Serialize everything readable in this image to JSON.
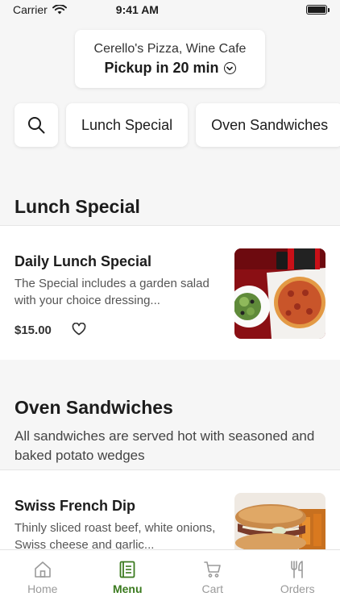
{
  "status_bar": {
    "carrier": "Carrier",
    "time": "9:41 AM"
  },
  "location": {
    "name": "Cerello's Pizza, Wine Cafe",
    "pickup": "Pickup in 20 min"
  },
  "categories": [
    "Lunch Special",
    "Oven Sandwiches"
  ],
  "sections": [
    {
      "title": "Lunch Special",
      "description": "",
      "items": [
        {
          "name": "Daily Lunch Special",
          "description": "The Special includes a garden salad with your choice dressing...",
          "price": "$15.00"
        }
      ]
    },
    {
      "title": "Oven Sandwiches",
      "description": "All sandwiches are served hot with seasoned and baked potato wedges",
      "items": [
        {
          "name": "Swiss French Dip",
          "description": "Thinly sliced roast beef, white onions, Swiss cheese and garlic...",
          "price": ""
        }
      ]
    }
  ],
  "nav": {
    "items": [
      {
        "label": "Home",
        "icon": "home-icon"
      },
      {
        "label": "Menu",
        "icon": "menu-icon"
      },
      {
        "label": "Cart",
        "icon": "cart-icon"
      },
      {
        "label": "Orders",
        "icon": "orders-icon"
      }
    ],
    "active": "Menu"
  },
  "colors": {
    "accent": "#3b7a1f",
    "inactive": "#9a9a9a",
    "background": "#f6f6f6"
  }
}
